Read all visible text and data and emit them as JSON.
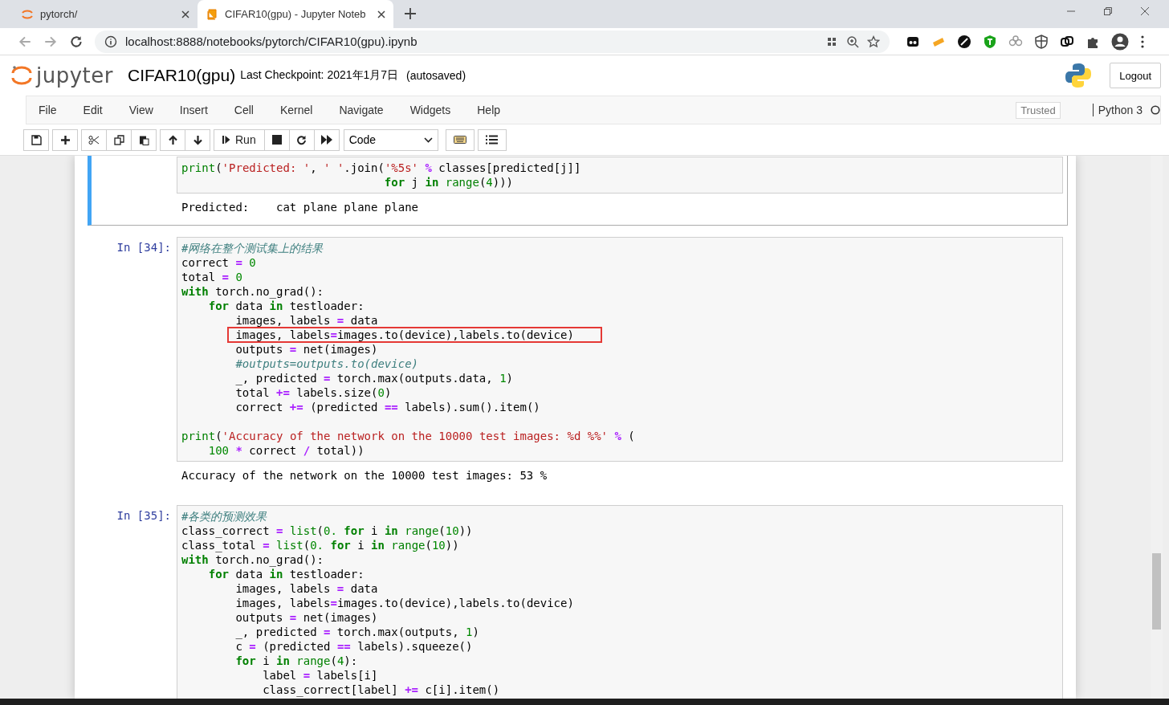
{
  "browser": {
    "tabs": [
      {
        "title": "pytorch/",
        "selected": false
      },
      {
        "title": "CIFAR10(gpu) - Jupyter Noteb",
        "selected": true
      }
    ],
    "address": "localhost:8888/notebooks/pytorch/CIFAR10(gpu).ipynb"
  },
  "header": {
    "logo": "jupyter",
    "notebook_name": "CIFAR10(gpu)",
    "checkpoint": "Last Checkpoint: 2021年1月7日",
    "autosave": "(autosaved)",
    "logout": "Logout"
  },
  "menu": {
    "items": [
      "File",
      "Edit",
      "View",
      "Insert",
      "Cell",
      "Kernel",
      "Navigate",
      "Widgets",
      "Help"
    ],
    "trusted": "Trusted",
    "kernel": "Python 3"
  },
  "toolbar": {
    "run": "Run",
    "cell_type": "Code"
  },
  "cells": [
    {
      "selected": true,
      "lines": [
        {
          "tokens": [
            {
              "kind": "builtin",
              "text": "print"
            },
            {
              "kind": "plain",
              "text": "("
            },
            {
              "kind": "str",
              "text": "'Predicted: '"
            },
            {
              "kind": "plain",
              "text": ", "
            },
            {
              "kind": "str",
              "text": "' '"
            },
            {
              "kind": "plain",
              "text": ".join("
            },
            {
              "kind": "str",
              "text": "'%5s'"
            },
            {
              "kind": "op",
              "text": " %"
            },
            {
              "kind": "plain",
              "text": " classes[predicted[j]]"
            }
          ],
          "children": [
            {
              "kind": "continuation",
              "tokens": [
                {
                  "kind": "kw",
                  "text": "for"
                },
                {
                  "kind": "plain",
                  "text": " j "
                },
                {
                  "kind": "kw",
                  "text": "in"
                },
                {
                  "kind": "builtin",
                  "text": " range"
                },
                {
                  "kind": "plain",
                  "text": "("
                },
                {
                  "kind": "num",
                  "text": "4"
                },
                {
                  "kind": "plain",
                  "text": ")))"
                }
              ]
            }
          ]
        }
      ],
      "output": "Predicted:    cat plane plane plane"
    },
    {
      "selected": false,
      "prompt": "In [34]:",
      "lines": [
        {
          "tokens": [
            {
              "kind": "comment",
              "text": "#网络在整个测试集上的结果"
            }
          ]
        },
        {
          "tokens": [
            {
              "kind": "plain",
              "text": "correct "
            },
            {
              "kind": "op",
              "text": "="
            },
            {
              "kind": "num",
              "text": " 0"
            }
          ]
        },
        {
          "tokens": [
            {
              "kind": "plain",
              "text": "total "
            },
            {
              "kind": "op",
              "text": "="
            },
            {
              "kind": "num",
              "text": " 0"
            }
          ]
        },
        {
          "tokens": [
            {
              "kind": "kw",
              "text": "with"
            },
            {
              "kind": "plain",
              "text": " torch.no_grad():"
            }
          ],
          "children": [
            {
              "tokens": [
                {
                  "kind": "kw",
                  "text": "for"
                },
                {
                  "kind": "plain",
                  "text": " data "
                },
                {
                  "kind": "kw",
                  "text": "in"
                },
                {
                  "kind": "plain",
                  "text": " testloader:"
                }
              ],
              "children": [
                {
                  "tokens": [
                    {
                      "kind": "plain",
                      "text": "images, labels "
                    },
                    {
                      "kind": "op",
                      "text": "="
                    },
                    {
                      "kind": "plain",
                      "text": " data"
                    }
                  ]
                },
                {
                  "boxed": true,
                  "tokens": [
                    {
                      "kind": "plain",
                      "text": "images, labels"
                    },
                    {
                      "kind": "op",
                      "text": "="
                    },
                    {
                      "kind": "plain",
                      "text": "images.to(device),labels.to(device)"
                    }
                  ]
                },
                {
                  "tokens": [
                    {
                      "kind": "plain",
                      "text": "outputs "
                    },
                    {
                      "kind": "op",
                      "text": "="
                    },
                    {
                      "kind": "plain",
                      "text": " net(images)"
                    }
                  ]
                },
                {
                  "tokens": [
                    {
                      "kind": "comment",
                      "text": "#outputs=outputs.to(device)"
                    }
                  ]
                },
                {
                  "tokens": [
                    {
                      "kind": "plain",
                      "text": "_, predicted "
                    },
                    {
                      "kind": "op",
                      "text": "="
                    },
                    {
                      "kind": "plain",
                      "text": " torch.max(outputs.data, "
                    },
                    {
                      "kind": "num",
                      "text": "1"
                    },
                    {
                      "kind": "plain",
                      "text": ")"
                    }
                  ]
                },
                {
                  "tokens": [
                    {
                      "kind": "plain",
                      "text": "total "
                    },
                    {
                      "kind": "op",
                      "text": "+="
                    },
                    {
                      "kind": "plain",
                      "text": " labels.size("
                    },
                    {
                      "kind": "num",
                      "text": "0"
                    },
                    {
                      "kind": "plain",
                      "text": ")"
                    }
                  ]
                },
                {
                  "tokens": [
                    {
                      "kind": "plain",
                      "text": "correct "
                    },
                    {
                      "kind": "op",
                      "text": "+="
                    },
                    {
                      "kind": "plain",
                      "text": " (predicted "
                    },
                    {
                      "kind": "op",
                      "text": "=="
                    },
                    {
                      "kind": "plain",
                      "text": " labels).sum().item()"
                    }
                  ]
                }
              ]
            }
          ]
        },
        {
          "kind": "blank"
        },
        {
          "tokens": [
            {
              "kind": "builtin",
              "text": "print"
            },
            {
              "kind": "plain",
              "text": "("
            },
            {
              "kind": "str",
              "text": "'Accuracy of the network on the 10000 test images: %d %%'"
            },
            {
              "kind": "op",
              "text": " %"
            },
            {
              "kind": "plain",
              "text": " ("
            }
          ],
          "children": [
            {
              "tokens": [
                {
                  "kind": "num",
                  "text": "100"
                },
                {
                  "kind": "op",
                  "text": " *"
                },
                {
                  "kind": "plain",
                  "text": " correct "
                },
                {
                  "kind": "op",
                  "text": "/"
                },
                {
                  "kind": "plain",
                  "text": " total))"
                }
              ]
            }
          ]
        }
      ],
      "output": "Accuracy of the network on the 10000 test images: 53 %"
    },
    {
      "selected": false,
      "prompt": "In [35]:",
      "lines": [
        {
          "tokens": [
            {
              "kind": "comment",
              "text": "#各类的预测效果"
            }
          ]
        },
        {
          "tokens": [
            {
              "kind": "plain",
              "text": "class_correct "
            },
            {
              "kind": "op",
              "text": "="
            },
            {
              "kind": "builtin",
              "text": " list"
            },
            {
              "kind": "plain",
              "text": "("
            },
            {
              "kind": "num",
              "text": "0."
            },
            {
              "kind": "kw",
              "text": " for"
            },
            {
              "kind": "plain",
              "text": " i "
            },
            {
              "kind": "kw",
              "text": "in"
            },
            {
              "kind": "builtin",
              "text": " range"
            },
            {
              "kind": "plain",
              "text": "("
            },
            {
              "kind": "num",
              "text": "10"
            },
            {
              "kind": "plain",
              "text": "))"
            }
          ]
        },
        {
          "tokens": [
            {
              "kind": "plain",
              "text": "class_total "
            },
            {
              "kind": "op",
              "text": "="
            },
            {
              "kind": "builtin",
              "text": " list"
            },
            {
              "kind": "plain",
              "text": "("
            },
            {
              "kind": "num",
              "text": "0."
            },
            {
              "kind": "kw",
              "text": " for"
            },
            {
              "kind": "plain",
              "text": " i "
            },
            {
              "kind": "kw",
              "text": "in"
            },
            {
              "kind": "builtin",
              "text": " range"
            },
            {
              "kind": "plain",
              "text": "("
            },
            {
              "kind": "num",
              "text": "10"
            },
            {
              "kind": "plain",
              "text": "))"
            }
          ]
        },
        {
          "tokens": [
            {
              "kind": "kw",
              "text": "with"
            },
            {
              "kind": "plain",
              "text": " torch.no_grad():"
            }
          ],
          "children": [
            {
              "tokens": [
                {
                  "kind": "kw",
                  "text": "for"
                },
                {
                  "kind": "plain",
                  "text": " data "
                },
                {
                  "kind": "kw",
                  "text": "in"
                },
                {
                  "kind": "plain",
                  "text": " testloader:"
                }
              ],
              "children": [
                {
                  "tokens": [
                    {
                      "kind": "plain",
                      "text": "images, labels "
                    },
                    {
                      "kind": "op",
                      "text": "="
                    },
                    {
                      "kind": "plain",
                      "text": " data"
                    }
                  ]
                },
                {
                  "tokens": [
                    {
                      "kind": "plain",
                      "text": "images, labels"
                    },
                    {
                      "kind": "op",
                      "text": "="
                    },
                    {
                      "kind": "plain",
                      "text": "images.to(device),labels.to(device)"
                    }
                  ]
                },
                {
                  "tokens": [
                    {
                      "kind": "plain",
                      "text": "outputs "
                    },
                    {
                      "kind": "op",
                      "text": "="
                    },
                    {
                      "kind": "plain",
                      "text": " net(images)"
                    }
                  ]
                },
                {
                  "tokens": [
                    {
                      "kind": "plain",
                      "text": "_, predicted "
                    },
                    {
                      "kind": "op",
                      "text": "="
                    },
                    {
                      "kind": "plain",
                      "text": " torch.max(outputs, "
                    },
                    {
                      "kind": "num",
                      "text": "1"
                    },
                    {
                      "kind": "plain",
                      "text": ")"
                    }
                  ]
                },
                {
                  "tokens": [
                    {
                      "kind": "plain",
                      "text": "c "
                    },
                    {
                      "kind": "op",
                      "text": "="
                    },
                    {
                      "kind": "plain",
                      "text": " (predicted "
                    },
                    {
                      "kind": "op",
                      "text": "=="
                    },
                    {
                      "kind": "plain",
                      "text": " labels).squeeze()"
                    }
                  ]
                },
                {
                  "tokens": [
                    {
                      "kind": "kw",
                      "text": "for"
                    },
                    {
                      "kind": "plain",
                      "text": " i "
                    },
                    {
                      "kind": "kw",
                      "text": "in"
                    },
                    {
                      "kind": "builtin",
                      "text": " range"
                    },
                    {
                      "kind": "plain",
                      "text": "("
                    },
                    {
                      "kind": "num",
                      "text": "4"
                    },
                    {
                      "kind": "plain",
                      "text": "):"
                    }
                  ],
                  "children": [
                    {
                      "tokens": [
                        {
                          "kind": "plain",
                          "text": "label "
                        },
                        {
                          "kind": "op",
                          "text": "="
                        },
                        {
                          "kind": "plain",
                          "text": " labels[i]"
                        }
                      ]
                    },
                    {
                      "tokens": [
                        {
                          "kind": "plain",
                          "text": "class_correct[label] "
                        },
                        {
                          "kind": "op",
                          "text": "+="
                        },
                        {
                          "kind": "plain",
                          "text": " c[i].item()"
                        }
                      ]
                    }
                  ]
                }
              ]
            }
          ]
        }
      ]
    }
  ]
}
